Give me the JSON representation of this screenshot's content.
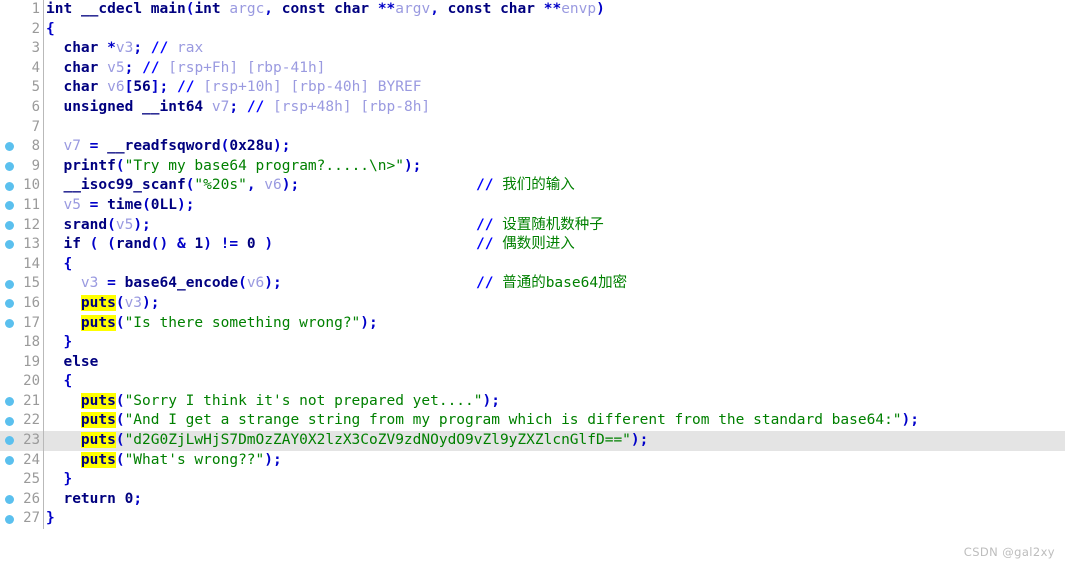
{
  "app": {
    "name": "decompiler-pseudocode-view",
    "theme": "light"
  },
  "colors": {
    "background": "#ffffff",
    "keyword": "#00007f",
    "string": "#008000",
    "comment": "#008000",
    "punctuation": "#0000c8",
    "variable": "#9a9ae0",
    "register_comment": "#9a9ae0",
    "type_gray": "#808080",
    "line_number": "#9a9a9a",
    "breakpoint_dot": "#5bc0ee",
    "highlight_identifier": "#ffff00",
    "current_line": "#e4e4e4",
    "watermark": "#bdbdbd"
  },
  "gutter": {
    "separator_color": "#b9b9b9",
    "dot_icon_name": "breakpoint-dot-icon"
  },
  "editor": {
    "highlighted_identifier": "puts",
    "current_line_number": 23,
    "total_lines": 27
  },
  "lines": [
    {
      "n": 1,
      "dot": false,
      "cur": false,
      "indent": 0,
      "text": "int __cdecl main(int argc, const char **argv, const char **envp)",
      "comment": ""
    },
    {
      "n": 2,
      "dot": false,
      "cur": false,
      "indent": 0,
      "text": "{",
      "comment": ""
    },
    {
      "n": 3,
      "dot": false,
      "cur": false,
      "indent": 1,
      "text": "char *v3; // rax",
      "comment": ""
    },
    {
      "n": 4,
      "dot": false,
      "cur": false,
      "indent": 1,
      "text": "char v5; // [rsp+Fh] [rbp-41h]",
      "comment": ""
    },
    {
      "n": 5,
      "dot": false,
      "cur": false,
      "indent": 1,
      "text": "char v6[56]; // [rsp+10h] [rbp-40h] BYREF",
      "comment": ""
    },
    {
      "n": 6,
      "dot": false,
      "cur": false,
      "indent": 1,
      "text": "unsigned __int64 v7; // [rsp+48h] [rbp-8h]",
      "comment": ""
    },
    {
      "n": 7,
      "dot": false,
      "cur": false,
      "indent": 0,
      "text": "",
      "comment": ""
    },
    {
      "n": 8,
      "dot": true,
      "cur": false,
      "indent": 1,
      "text": "v7 = __readfsqword(0x28u);",
      "comment": ""
    },
    {
      "n": 9,
      "dot": true,
      "cur": false,
      "indent": 1,
      "text": "printf(\"Try my base64 program?.....\\n>\");",
      "comment": ""
    },
    {
      "n": 10,
      "dot": true,
      "cur": false,
      "indent": 1,
      "text": "__isoc99_scanf(\"%20s\", v6);",
      "comment": "// 我们的输入"
    },
    {
      "n": 11,
      "dot": true,
      "cur": false,
      "indent": 1,
      "text": "v5 = time(0LL);",
      "comment": ""
    },
    {
      "n": 12,
      "dot": true,
      "cur": false,
      "indent": 1,
      "text": "srand(v5);",
      "comment": "// 设置随机数种子"
    },
    {
      "n": 13,
      "dot": true,
      "cur": false,
      "indent": 1,
      "text": "if ( (rand() & 1) != 0 )",
      "comment": "// 偶数则进入"
    },
    {
      "n": 14,
      "dot": false,
      "cur": false,
      "indent": 1,
      "text": "{",
      "comment": ""
    },
    {
      "n": 15,
      "dot": true,
      "cur": false,
      "indent": 2,
      "text": "v3 = base64_encode(v6);",
      "comment": "// 普通的base64加密"
    },
    {
      "n": 16,
      "dot": true,
      "cur": false,
      "indent": 2,
      "text": "puts(v3);",
      "comment": ""
    },
    {
      "n": 17,
      "dot": true,
      "cur": false,
      "indent": 2,
      "text": "puts(\"Is there something wrong?\");",
      "comment": ""
    },
    {
      "n": 18,
      "dot": false,
      "cur": false,
      "indent": 1,
      "text": "}",
      "comment": ""
    },
    {
      "n": 19,
      "dot": false,
      "cur": false,
      "indent": 1,
      "text": "else",
      "comment": ""
    },
    {
      "n": 20,
      "dot": false,
      "cur": false,
      "indent": 1,
      "text": "{",
      "comment": ""
    },
    {
      "n": 21,
      "dot": true,
      "cur": false,
      "indent": 2,
      "text": "puts(\"Sorry I think it's not prepared yet....\");",
      "comment": ""
    },
    {
      "n": 22,
      "dot": true,
      "cur": false,
      "indent": 2,
      "text": "puts(\"And I get a strange string from my program which is different from the standard base64:\");",
      "comment": ""
    },
    {
      "n": 23,
      "dot": true,
      "cur": true,
      "indent": 2,
      "text": "puts(\"d2G0ZjLwHjS7DmOzZAY0X2lzX3CoZV9zdNOydO9vZl9yZXZlcnGlfD==\");",
      "comment": ""
    },
    {
      "n": 24,
      "dot": true,
      "cur": false,
      "indent": 2,
      "text": "puts(\"What's wrong??\");",
      "comment": ""
    },
    {
      "n": 25,
      "dot": false,
      "cur": false,
      "indent": 1,
      "text": "}",
      "comment": ""
    },
    {
      "n": 26,
      "dot": true,
      "cur": false,
      "indent": 1,
      "text": "return 0;",
      "comment": ""
    },
    {
      "n": 27,
      "dot": true,
      "cur": false,
      "indent": 0,
      "text": "}",
      "comment": ""
    }
  ],
  "watermark": {
    "text": "CSDN @gal2xy"
  }
}
